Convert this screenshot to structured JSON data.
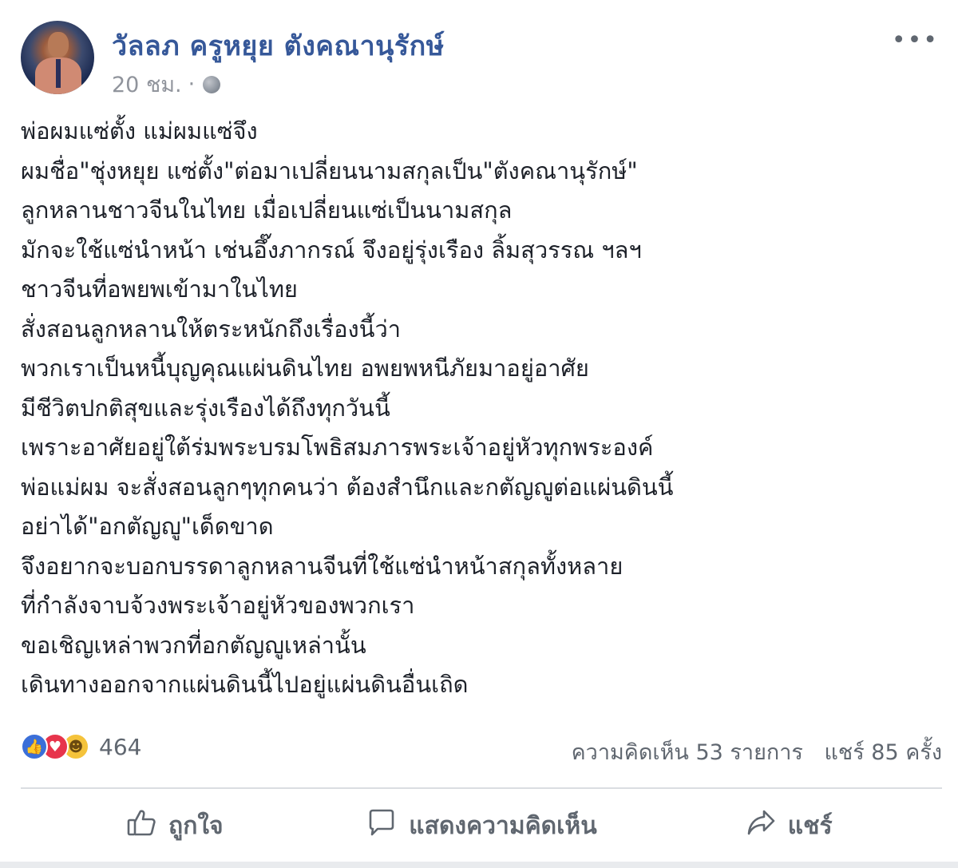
{
  "post": {
    "author": "วัลลภ ครูหยุย ตังคณานุรักษ์",
    "time": "20 ชม.",
    "separator": "·",
    "privacy_icon": "globe-icon",
    "more_icon": "more-dots-icon",
    "more_label": "•••",
    "lines": [
      "พ่อผมแซ่ตั้ง แม่ผมแซ่จึง",
      "ผมชื่อ\"ชุ่งหยุย แซ่ตั้ง\"ต่อมาเปลี่ยนนามสกุลเป็น\"ตังคณานุรักษ์\"",
      "ลูกหลานชาวจีนในไทย เมื่อเปลี่ยนแซ่เป็นนามสกุล",
      "มักจะใช้แซ่นำหน้า เช่นอึ๊งภากรณ์ จึงอยู่รุ่งเรือง ลิ้มสุวรรณ ฯลฯ",
      "ชาวจีนที่อพยพเข้ามาในไทย",
      "สั่งสอนลูกหลานให้ตระหนักถึงเรื่องนี้ว่า",
      "พวกเราเป็นหนี้บุญคุณแผ่นดินไทย อพยพหนีภัยมาอยู่อาศัย",
      "มีชีวิตปกติสุขและรุ่งเรืองได้ถึงทุกวันนี้",
      "เพราะอาศัยอยู่ใต้ร่มพระบรมโพธิสมภารพระเจ้าอยู่หัวทุกพระองค์",
      "พ่อแม่ผม จะสั่งสอนลูกๆทุกคนว่า ต้องสำนึกและกตัญญูต่อแผ่นดินนี้",
      "อย่าได้\"อกตัญญู\"เด็ดขาด",
      "จึงอยากจะบอกบรรดาลูกหลานจีนที่ใช้แซ่นำหน้าสกุลทั้งหลาย",
      "ที่กำลังจาบจ้วงพระเจ้าอยู่หัวของพวกเรา",
      "ขอเชิญเหล่าพวกที่อกตัญญูเหล่านั้น",
      "เดินทางออกจากแผ่นดินนี้ไปอยู่แผ่นดินอื่นเถิด"
    ]
  },
  "stats": {
    "reactions": [
      "like",
      "love",
      "haha"
    ],
    "reaction_count": "464",
    "comments": "ความคิดเห็น 53 รายการ",
    "shares": "แชร์ 85 ครั้ง"
  },
  "actions": {
    "like_label": "ถูกใจ",
    "comment_label": "แสดงความคิดเห็น",
    "share_label": "แชร์"
  },
  "colors": {
    "author": "#365899",
    "meta": "#90949c",
    "text": "#1d2129",
    "action": "#606770",
    "like": "#3b6fd8",
    "love": "#e7344c",
    "haha": "#f5c33b"
  }
}
